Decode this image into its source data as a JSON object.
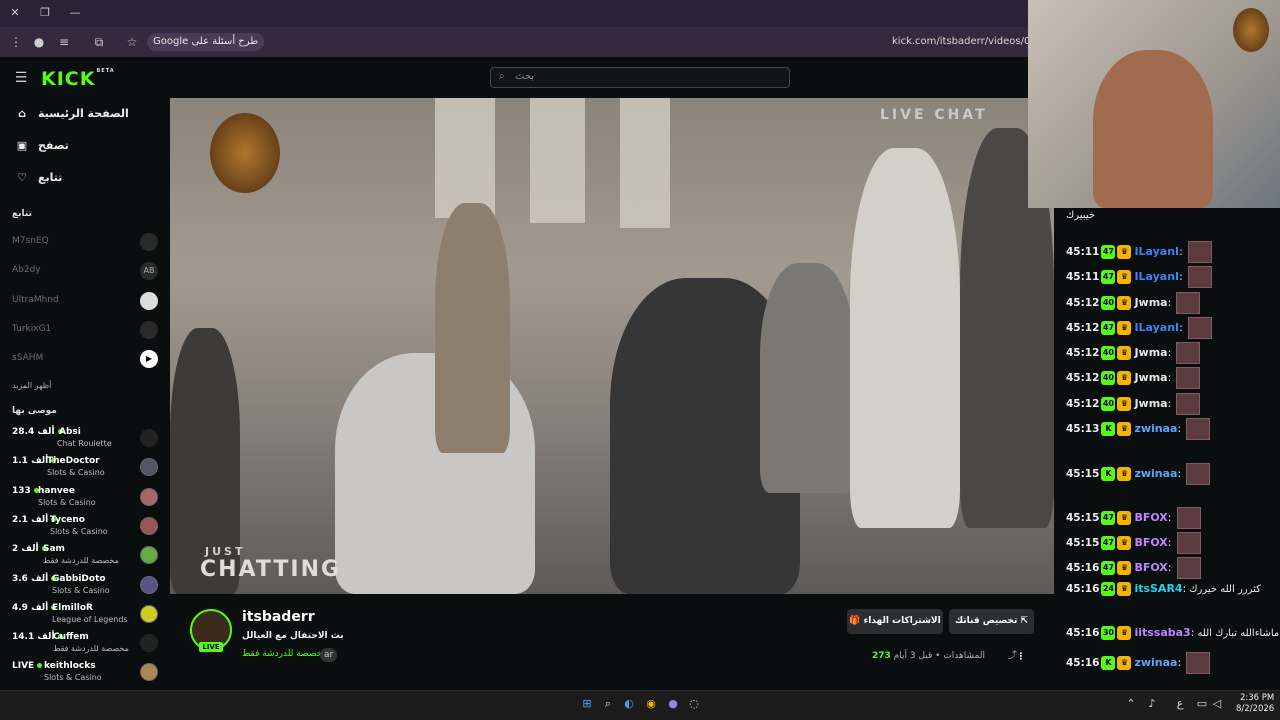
{
  "browser": {
    "chip_label": "Google طرح أسئلة على",
    "url": "kick.com/itsbaderr/videos/019fb3",
    "icons": [
      "close-icon",
      "restore-icon",
      "minimize-icon",
      "menu-dots-icon",
      "extensions-icon",
      "star-icon"
    ]
  },
  "header": {
    "logo": "KICK",
    "logo_tag": "BETA",
    "search_placeholder": "بحث"
  },
  "sidebar": {
    "nav": [
      {
        "label": "الصفحة الرئيسية",
        "icon": "home-icon"
      },
      {
        "label": "تصفح",
        "icon": "browse-icon"
      },
      {
        "label": "تتابع",
        "icon": "heart-icon"
      }
    ],
    "following_title": "تتابع",
    "following": [
      "M7snEQ",
      "Ab2dy",
      "UltraMhnd",
      "TurkixG1",
      "sSAHM"
    ],
    "show_more": "أظهر المزيد",
    "recommended_title": "موصى بها",
    "recommended": [
      {
        "views": "28.4 ألف",
        "name": "Absi",
        "category": "Chat Roulette"
      },
      {
        "views": "1.1 ألف",
        "name": "TheDoctor",
        "category": "Slots & Casino"
      },
      {
        "views": "133",
        "name": "hanvee",
        "category": "Slots & Casino"
      },
      {
        "views": "2.1 ألف",
        "name": "Tyceno",
        "category": "Slots & Casino"
      },
      {
        "views": "2 ألف",
        "name": "Sam",
        "category": "مخصصة للدردشة فقط"
      },
      {
        "views": "3.6 ألف",
        "name": "GabbiDoto",
        "category": "Slots & Casino"
      },
      {
        "views": "4.9 ألف",
        "name": "ElmilloR",
        "category": "League of Legends"
      },
      {
        "views": "14.1 ألف",
        "name": "Cuffem",
        "category": "مخصصة للدردشة فقط"
      },
      {
        "views": "LIVE",
        "name": "keithlocks",
        "category": "Slots & Casino"
      }
    ]
  },
  "player": {
    "overlay_small": "JUST",
    "overlay_big": "CHATTING",
    "overlay_right": "LIVE CHAT"
  },
  "channel": {
    "name": "itsbaderr",
    "live": "LIVE",
    "title": "بث الاحتفال مع العيالل",
    "category": "مخصصة للدردشة فقط",
    "language": "ar",
    "btn_gifts": "الاشتراكات الهداء",
    "btn_clip": "تخصيص قناتك",
    "views": "273",
    "views_label": "المشاهدات",
    "time_ago": "قبل 3 أيام"
  },
  "chat": {
    "top_text": "خيبيرك",
    "messages": [
      {
        "time": "45:11",
        "badge": "47",
        "user": "ILayanI",
        "color": "#3b82f6",
        "text": ""
      },
      {
        "time": "45:11",
        "badge": "47",
        "user": "ILayanI",
        "color": "#3b82f6",
        "text": ""
      },
      {
        "time": "45:12",
        "badge": "40",
        "user": "Jwma",
        "color": "#e8e8e8",
        "text": ""
      },
      {
        "time": "45:12",
        "badge": "47",
        "user": "ILayanI",
        "color": "#3b82f6",
        "text": ""
      },
      {
        "time": "45:12",
        "badge": "40",
        "user": "Jwma",
        "color": "#e8e8e8",
        "text": ""
      },
      {
        "time": "45:12",
        "badge": "40",
        "user": "Jwma",
        "color": "#e8e8e8",
        "text": ""
      },
      {
        "time": "45:12",
        "badge": "40",
        "user": "Jwma",
        "color": "#e8e8e8",
        "text": ""
      },
      {
        "time": "45:13",
        "badge": "K",
        "user": "zwinaa",
        "color": "#60a5fa",
        "text": ""
      },
      {
        "time": "45:15",
        "badge": "K",
        "user": "zwinaa",
        "color": "#60a5fa",
        "text": ""
      },
      {
        "time": "45:15",
        "badge": "47",
        "user": "BFOX",
        "color": "#c084fc",
        "text": ""
      },
      {
        "time": "45:15",
        "badge": "47",
        "user": "BFOX",
        "color": "#c084fc",
        "text": ""
      },
      {
        "time": "45:16",
        "badge": "47",
        "user": "BFOX",
        "color": "#c084fc",
        "text": ""
      },
      {
        "time": "45:16",
        "badge": "24",
        "user": "itsSAR4",
        "color": "#22d3ee",
        "text": "كثررر الله خيررك"
      },
      {
        "time": "45:16",
        "badge": "30",
        "user": "iitssaba3",
        "color": "#c084fc",
        "text": "ماشاءالله تبارك الله"
      },
      {
        "time": "45:16",
        "badge": "K",
        "user": "zwinaa",
        "color": "#60a5fa",
        "text": ""
      }
    ]
  },
  "taskbar": {
    "time": "2:36 PM",
    "date": "8/2/2026",
    "lang": "ع"
  }
}
